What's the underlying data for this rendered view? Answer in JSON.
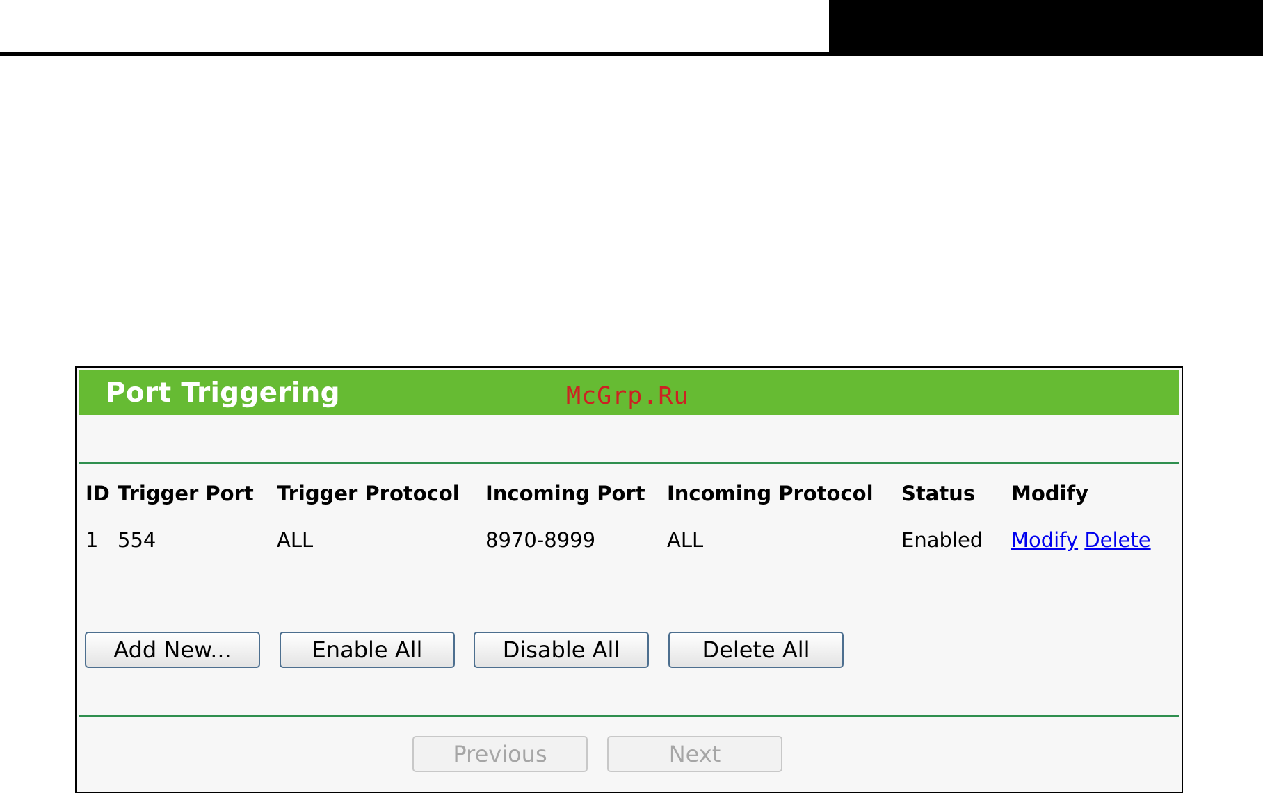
{
  "panel": {
    "title": "Port Triggering",
    "watermark": "McGrp.Ru"
  },
  "table": {
    "headers": {
      "id": "ID",
      "trigger_port": "Trigger Port",
      "trigger_protocol": "Trigger Protocol",
      "incoming_port": "Incoming Port",
      "incoming_protocol": "Incoming Protocol",
      "status": "Status",
      "modify": "Modify"
    },
    "rows": [
      {
        "id": "1",
        "trigger_port": "554",
        "trigger_protocol": "ALL",
        "incoming_port": "8970-8999",
        "incoming_protocol": "ALL",
        "status": "Enabled",
        "modify_link": "Modify",
        "delete_link": "Delete"
      }
    ]
  },
  "actions": {
    "add_new": "Add New...",
    "enable_all": "Enable All",
    "disable_all": "Disable All",
    "delete_all": "Delete All"
  },
  "pagination": {
    "previous": "Previous",
    "next": "Next"
  },
  "colors": {
    "title_bar": "#66bb33",
    "divider": "#2f8f4f",
    "watermark": "#cc2222",
    "link": "#0000ee"
  }
}
